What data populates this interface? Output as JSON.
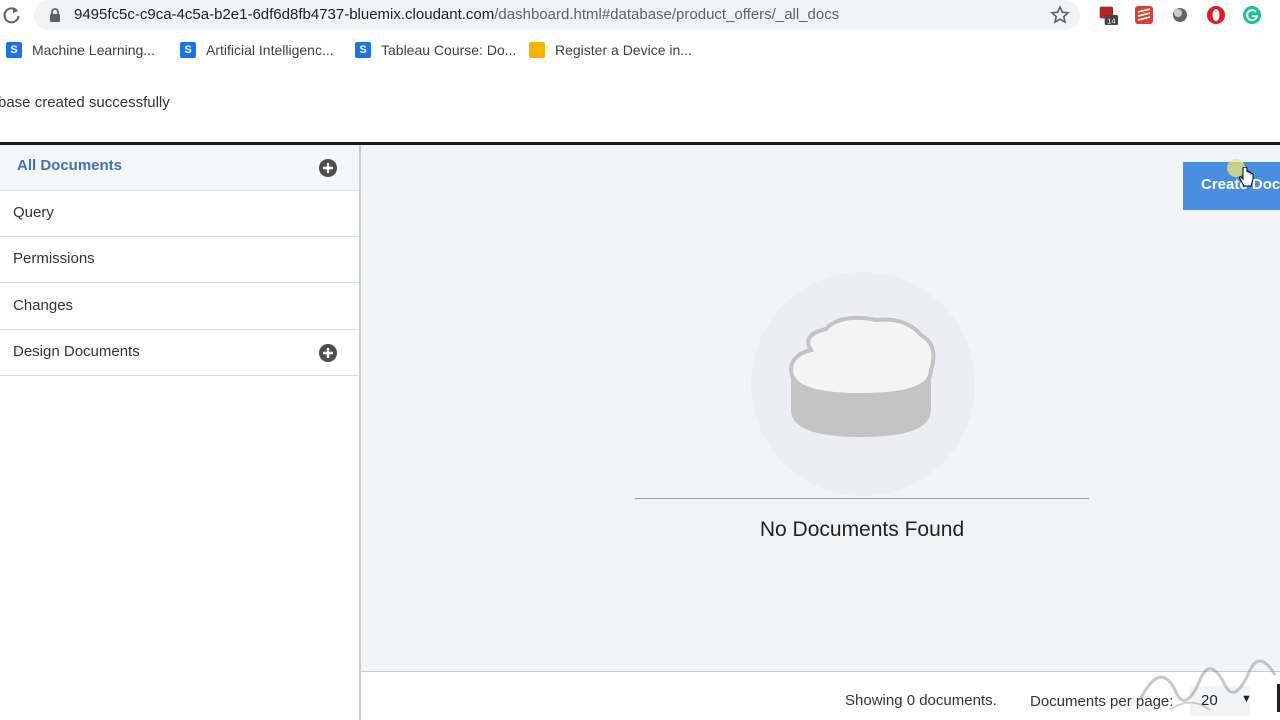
{
  "browser": {
    "url_main": "9495fc5c-c9ca-4c5a-b2e1-6df6d8fb4737-bluemix.cloudant.com",
    "url_path": "/dashboard.html#database/product_offers/_all_docs",
    "extension_badge": "14",
    "icons": [
      "reload-icon",
      "lock-icon",
      "star-icon",
      "extension-icon",
      "todoist-icon",
      "circle-icon",
      "opera-icon",
      "grammarly-icon"
    ]
  },
  "bookmarks": [
    {
      "fav": "S",
      "label": "Machine Learning..."
    },
    {
      "fav": "S",
      "label": "Artificial Intelligenc..."
    },
    {
      "fav": "S",
      "label": "Tableau Course: Do..."
    },
    {
      "fav": "",
      "label": "Register a Device in..."
    }
  ],
  "notification": {
    "text": "base created successfully"
  },
  "sidebar": {
    "items": [
      {
        "label": "All Documents",
        "active": true,
        "has_add": true
      },
      {
        "label": "Query"
      },
      {
        "label": "Permissions"
      },
      {
        "label": "Changes"
      },
      {
        "label": "Design Documents",
        "has_add": true
      }
    ]
  },
  "main": {
    "create_button": "Create Doc",
    "empty_message": "No Documents Found",
    "accent_color": "#4a8ee0"
  },
  "footer": {
    "showing": "Showing 0 documents.",
    "per_page_label": "Documents per page:",
    "per_page_value": "20"
  }
}
